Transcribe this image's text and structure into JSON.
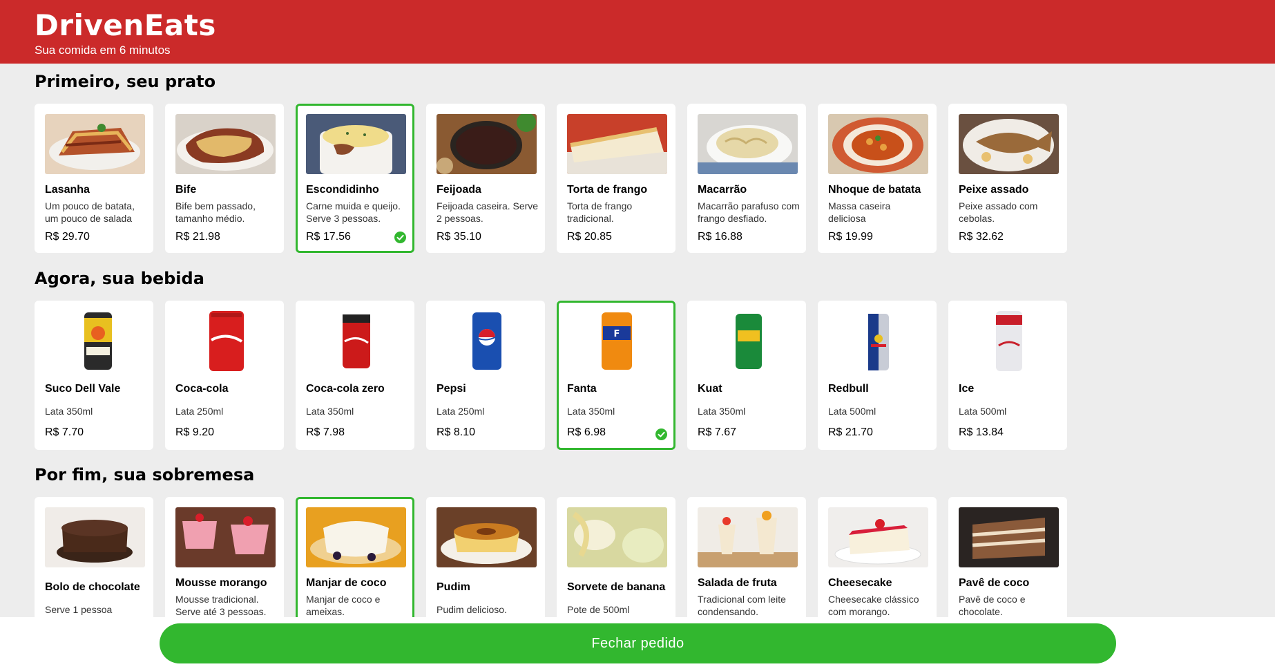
{
  "header": {
    "title": "DrivenEats",
    "subtitle": "Sua comida em 6 minutos",
    "background_color": "#cb2a2a"
  },
  "sections": [
    {
      "title": "Primeiro, seu prato",
      "items": [
        {
          "name": "Lasanha",
          "description": "Um pouco de batata, um pouco de salada",
          "price": "R$ 29.70",
          "selected": false
        },
        {
          "name": "Bife",
          "description": "Bife bem passado, tamanho médio.",
          "price": "R$ 21.98",
          "selected": false
        },
        {
          "name": "Escondidinho",
          "description": "Carne muida e queijo. Serve 3 pessoas.",
          "price": "R$ 17.56",
          "selected": true
        },
        {
          "name": "Feijoada",
          "description": "Feijoada caseira. Serve 2 pessoas.",
          "price": "R$ 35.10",
          "selected": false
        },
        {
          "name": "Torta de frango",
          "description": "Torta de frango tradicional.",
          "price": "R$ 20.85",
          "selected": false
        },
        {
          "name": "Macarrão",
          "description": "Macarrão parafuso com frango desfiado.",
          "price": "R$ 16.88",
          "selected": false
        },
        {
          "name": "Nhoque de batata",
          "description": "Massa caseira deliciosa",
          "price": "R$ 19.99",
          "selected": false
        },
        {
          "name": "Peixe assado",
          "description": "Peixe assado com cebolas.",
          "price": "R$ 32.62",
          "selected": false
        }
      ]
    },
    {
      "title": "Agora, sua bebida",
      "items": [
        {
          "name": "Suco Dell Vale",
          "description": "Lata 350ml",
          "price": "R$ 7.70",
          "selected": false
        },
        {
          "name": "Coca-cola",
          "description": "Lata 250ml",
          "price": "R$ 9.20",
          "selected": false
        },
        {
          "name": "Coca-cola zero",
          "description": "Lata 350ml",
          "price": "R$ 7.98",
          "selected": false
        },
        {
          "name": "Pepsi",
          "description": "Lata 250ml",
          "price": "R$ 8.10",
          "selected": false
        },
        {
          "name": "Fanta",
          "description": "Lata 350ml",
          "price": "R$ 6.98",
          "selected": true
        },
        {
          "name": "Kuat",
          "description": "Lata 350ml",
          "price": "R$ 7.67",
          "selected": false
        },
        {
          "name": "Redbull",
          "description": "Lata 500ml",
          "price": "R$ 21.70",
          "selected": false
        },
        {
          "name": "Ice",
          "description": "Lata 500ml",
          "price": "R$ 13.84",
          "selected": false
        }
      ]
    },
    {
      "title": "Por fim, sua sobremesa",
      "items": [
        {
          "name": "Bolo de chocolate",
          "description": "Serve 1 pessoa",
          "selected": false
        },
        {
          "name": "Mousse morango",
          "description": "Mousse tradicional. Serve até 3 pessoas.",
          "selected": false
        },
        {
          "name": "Manjar de coco",
          "description": "Manjar de coco e ameixas.",
          "selected": true
        },
        {
          "name": "Pudim",
          "description": "Pudim delicioso.",
          "selected": false
        },
        {
          "name": "Sorvete de banana",
          "description": "Pote de 500ml",
          "selected": false
        },
        {
          "name": "Salada de fruta",
          "description": "Tradicional com leite condensando.",
          "selected": false
        },
        {
          "name": "Cheesecake",
          "description": "Cheesecake clássico com morango.",
          "selected": false
        },
        {
          "name": "Pavê de coco",
          "description": "Pavê de coco e chocolate.",
          "selected": false
        }
      ]
    }
  ],
  "footer": {
    "button_label": "Fechar pedido",
    "button_color": "#32b72f"
  },
  "colors": {
    "accent_selected": "#32b72f",
    "page_background": "#ededed"
  }
}
